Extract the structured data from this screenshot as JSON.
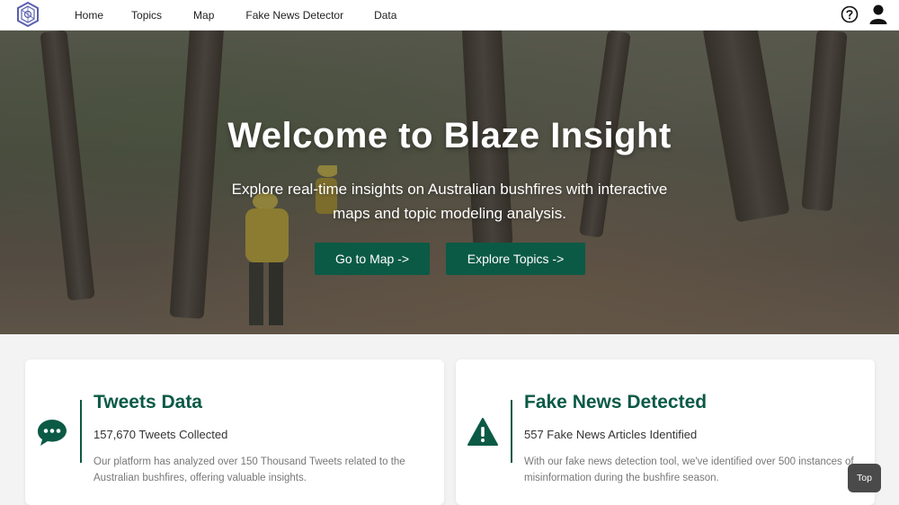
{
  "nav": {
    "logo_icon": "compass-logo-icon",
    "links": [
      "Home",
      "Topics",
      "Map",
      "Fake News Detector",
      "Data"
    ],
    "help_icon": "question-circle-icon",
    "user_icon": "user-icon"
  },
  "hero": {
    "title": "Welcome to Blaze Insight",
    "subtitle": "Explore real-time insights on Australian bushfires with interactive maps and topic modeling analysis.",
    "map_button": "Go to Map ->",
    "topics_button": "Explore Topics ->"
  },
  "cards": [
    {
      "icon": "chat-bubble-icon",
      "title": "Tweets Data",
      "stat": "157,670 Tweets Collected",
      "description": "Our platform has analyzed over 150 Thousand Tweets related to the Australian bushfires, offering valuable insights."
    },
    {
      "icon": "warning-triangle-icon",
      "title": "Fake News Detected",
      "stat": "557 Fake News Articles Identified",
      "description": "With our fake news detection tool, we've identified over 500 instances of misinformation during the bushfire season."
    }
  ],
  "top_button": "Top",
  "colors": {
    "accent": "#0b5a45",
    "nav_bg": "#ffffff",
    "page_bg": "#f3f3f3"
  }
}
